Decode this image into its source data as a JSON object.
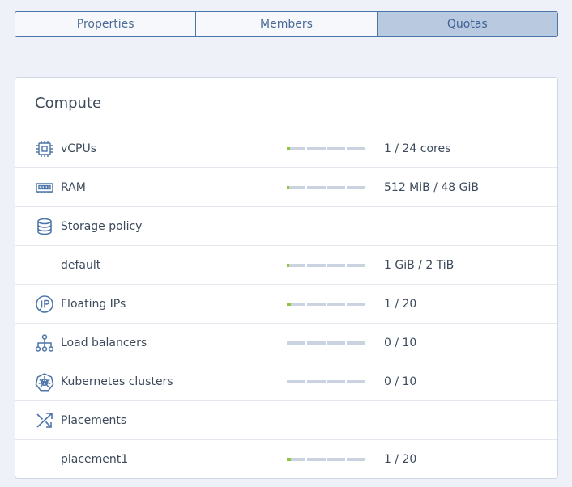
{
  "tabs": [
    {
      "label": "Properties",
      "active": false
    },
    {
      "label": "Members",
      "active": false
    },
    {
      "label": "Quotas",
      "active": true
    }
  ],
  "section": {
    "title": "Compute"
  },
  "rows": [
    {
      "icon": "cpu-icon",
      "label": "vCPUs",
      "value": "1 / 24 cores",
      "usage": 0.042,
      "has_bar": true,
      "indent": false
    },
    {
      "icon": "ram-icon",
      "label": "RAM",
      "value": "512 MiB / 48 GiB",
      "usage": 0.01,
      "has_bar": true,
      "indent": false
    },
    {
      "icon": "database-icon",
      "label": "Storage policy",
      "value": "",
      "usage": 0,
      "has_bar": false,
      "indent": false
    },
    {
      "icon": "",
      "label": "default",
      "value": "1 GiB / 2 TiB",
      "usage": 0.0005,
      "has_bar": true,
      "indent": true
    },
    {
      "icon": "floating-ip-icon",
      "label": "Floating IPs",
      "value": "1 / 20",
      "usage": 0.05,
      "has_bar": true,
      "indent": false
    },
    {
      "icon": "load-balancer-icon",
      "label": "Load balancers",
      "value": "0 / 10",
      "usage": 0,
      "has_bar": true,
      "indent": false
    },
    {
      "icon": "kubernetes-icon",
      "label": "Kubernetes clusters",
      "value": "0 / 10",
      "usage": 0,
      "has_bar": true,
      "indent": false
    },
    {
      "icon": "placements-icon",
      "label": "Placements",
      "value": "",
      "usage": 0,
      "has_bar": false,
      "indent": false
    },
    {
      "icon": "",
      "label": "placement1",
      "value": "1 / 20",
      "usage": 0.05,
      "has_bar": true,
      "indent": true
    }
  ],
  "colors": {
    "accent": "#4b74a8",
    "usage_fill": "#8cc63f",
    "bar_track": "#cbd3e0"
  }
}
